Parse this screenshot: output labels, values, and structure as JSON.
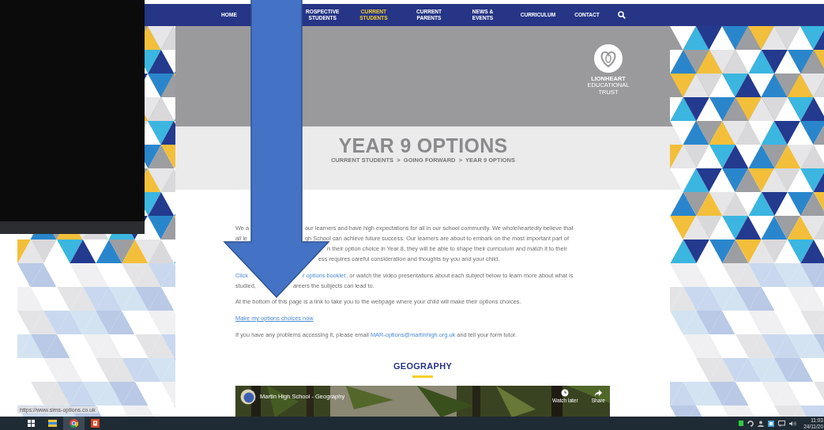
{
  "nav": {
    "items": [
      {
        "lines": [
          "HOME"
        ],
        "selected": false
      },
      {
        "lines": [
          "ROSPECTIVE",
          "STUDENTS"
        ],
        "selected": false
      },
      {
        "lines": [
          "CURRENT",
          "STUDENTS"
        ],
        "selected": true
      },
      {
        "lines": [
          "CURRENT",
          "PARENTS"
        ],
        "selected": false
      },
      {
        "lines": [
          "NEWS &",
          "EVENTS"
        ],
        "selected": false
      },
      {
        "lines": [
          "CURRICULUM"
        ],
        "selected": false
      },
      {
        "lines": [
          "CONTACT"
        ],
        "selected": false
      }
    ]
  },
  "logo": {
    "lines": [
      "LIONHEART",
      "EDUCATIONAL",
      "TRUST"
    ]
  },
  "hero": {
    "title": "YEAR 9 OPTIONS",
    "breadcrumb": "CURRENT STUDENTS  >  GOING FORWARD  >  YEAR 9 OPTIONS"
  },
  "intro": [
    {
      "left": [
        {
          "text": "We a",
          "link": false
        }
      ],
      "right": [
        {
          "text": "our learners and have high expectations for all in our school community. We wholeheartedly believe that",
          "link": false
        }
      ]
    },
    {
      "left": [
        {
          "text": "all le",
          "link": false
        }
      ],
      "right": [
        {
          "text": "gh School can achieve future success. Our learners are about to embark on the most important part of",
          "link": false
        }
      ]
    },
    {
      "right": [
        {
          "text": "n their option choice in Year 8, they will be able to shape their curriculum and match it to their",
          "link": false
        }
      ]
    },
    {
      "right": [
        {
          "text": "ess requires careful consideration and thoughts by you and your child.",
          "link": false
        }
      ]
    }
  ],
  "booklet": [
    {
      "left": [
        {
          "text": "Click",
          "link": true
        }
      ],
      "right": [
        {
          "text": "r options booklet",
          "link": true
        },
        {
          "text": ", or watch the video presentations about each subject below to learn more about what is",
          "link": false
        }
      ]
    },
    {
      "left": [
        {
          "text": "studied,",
          "link": false
        }
      ],
      "right": [
        {
          "text": "areers the subjects can lead to.",
          "link": false
        }
      ]
    }
  ],
  "bottom_note": "At the bottom of this page is a link to take you to the webpage where your child will make their options choices.",
  "options_link": "Make my options choices now",
  "contact": {
    "before": "If you have any problems accessing it, please email ",
    "email": "MAR-options@martinhigh.org.uk",
    "after": " and tell your form tutor."
  },
  "section": {
    "heading": "GEOGRAPHY",
    "video": {
      "title": "Martin High School - Geography",
      "watch_later": "Watch later",
      "share": "Share"
    }
  },
  "status_url": "https://www.sims-options.co.uk",
  "taskbar": {
    "apps": [
      {
        "kind": "start",
        "selected": false
      },
      {
        "kind": "folder",
        "selected": false
      },
      {
        "kind": "browser",
        "selected": true
      },
      {
        "kind": "slides",
        "selected": false
      }
    ],
    "time": "11:03",
    "date": "24/11/20"
  }
}
